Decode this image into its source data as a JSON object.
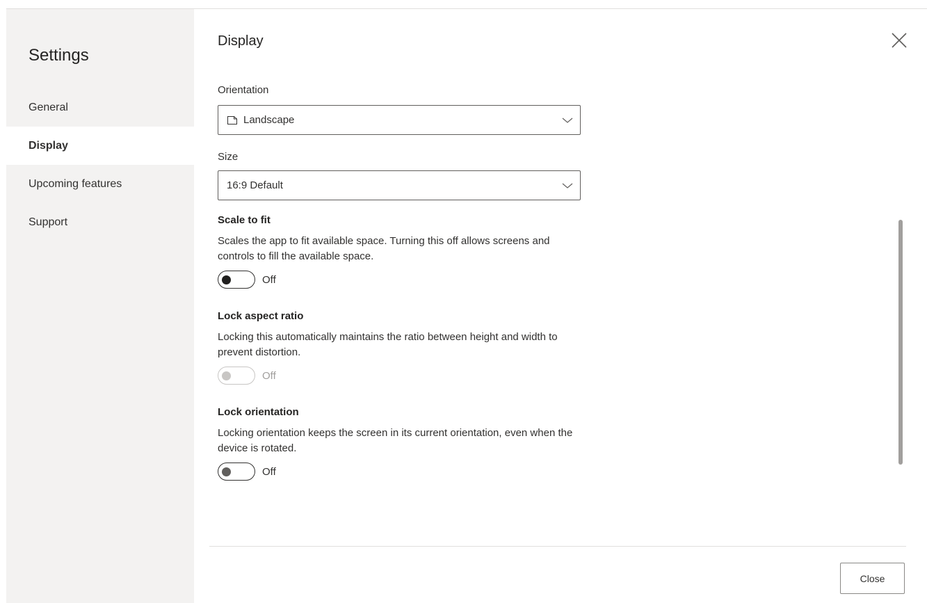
{
  "sidebar": {
    "title": "Settings",
    "items": [
      {
        "label": "General"
      },
      {
        "label": "Display"
      },
      {
        "label": "Upcoming features"
      },
      {
        "label": "Support"
      }
    ],
    "active": "Display"
  },
  "panel": {
    "title": "Display",
    "close_icon": "close-icon"
  },
  "orientation": {
    "label": "Orientation",
    "value": "Landscape",
    "icon": "page-landscape-icon"
  },
  "size": {
    "label": "Size",
    "value": "16:9 Default"
  },
  "scale_to_fit": {
    "title": "Scale to fit",
    "description": "Scales the app to fit available space. Turning this off allows screens and controls to fill the available space.",
    "state": "Off"
  },
  "lock_aspect_ratio": {
    "title": "Lock aspect ratio",
    "description": "Locking this automatically maintains the ratio between height and width to prevent distortion.",
    "state": "Off",
    "disabled": true
  },
  "lock_orientation": {
    "title": "Lock orientation",
    "description": "Locking orientation keeps the screen in its current orientation, even when the device is rotated.",
    "state": "Off"
  },
  "footer": {
    "close_label": "Close"
  },
  "colors": {
    "sidebar_bg": "#f3f2f1",
    "text": "#323130",
    "border": "#605e5c",
    "disabled": "#c8c6c4"
  }
}
